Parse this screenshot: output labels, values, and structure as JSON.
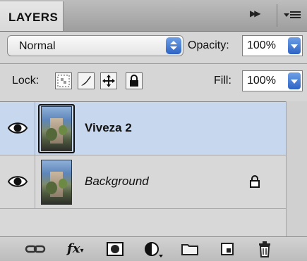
{
  "panel": {
    "tab_label": "LAYERS",
    "collapse_glyph": "▶▶"
  },
  "blend": {
    "mode": "Normal"
  },
  "opacity": {
    "label": "Opacity:",
    "value": "100%"
  },
  "lock": {
    "label": "Lock:"
  },
  "fill": {
    "label": "Fill:",
    "value": "100%"
  },
  "layers": [
    {
      "name": "Viveza 2",
      "selected": true,
      "visible": true,
      "locked": false
    },
    {
      "name": "Background",
      "selected": false,
      "visible": true,
      "locked": true
    }
  ],
  "colors": {
    "selection": "#c7d7ee",
    "accent_blue": "#2d63c5"
  },
  "footer_icons": [
    "link-layers-icon",
    "fx-icon",
    "layer-mask-icon",
    "adjustment-layer-icon",
    "new-group-icon",
    "new-layer-icon",
    "trash-icon"
  ]
}
